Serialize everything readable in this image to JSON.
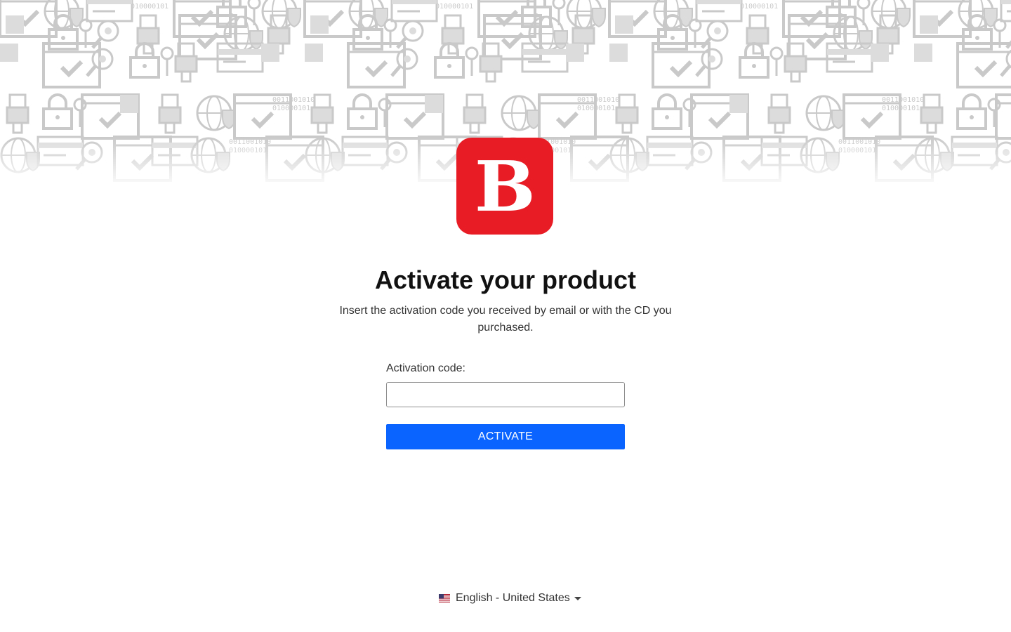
{
  "brand": {
    "logo_letter": "B",
    "logo_color": "#e81c25"
  },
  "page": {
    "title": "Activate your product",
    "subtitle": "Insert the activation code you received by email or with the CD you purchased."
  },
  "form": {
    "code_label": "Activation code:",
    "code_value": "",
    "code_placeholder": "",
    "activate_label": "ACTIVATE",
    "accent": "#0a64ff"
  },
  "footer": {
    "language_label": "English - United States",
    "language_flag": "us-flag-icon"
  },
  "background": {
    "pattern_icons": [
      "globe-shield-icon",
      "browser-check-icon",
      "padlock-key-icon",
      "ethernet-plug-icon",
      "credit-card-icon",
      "magnifier-bug-icon",
      "binary-code-icon"
    ],
    "binary_text": [
      "0011001010",
      "010000101"
    ]
  }
}
